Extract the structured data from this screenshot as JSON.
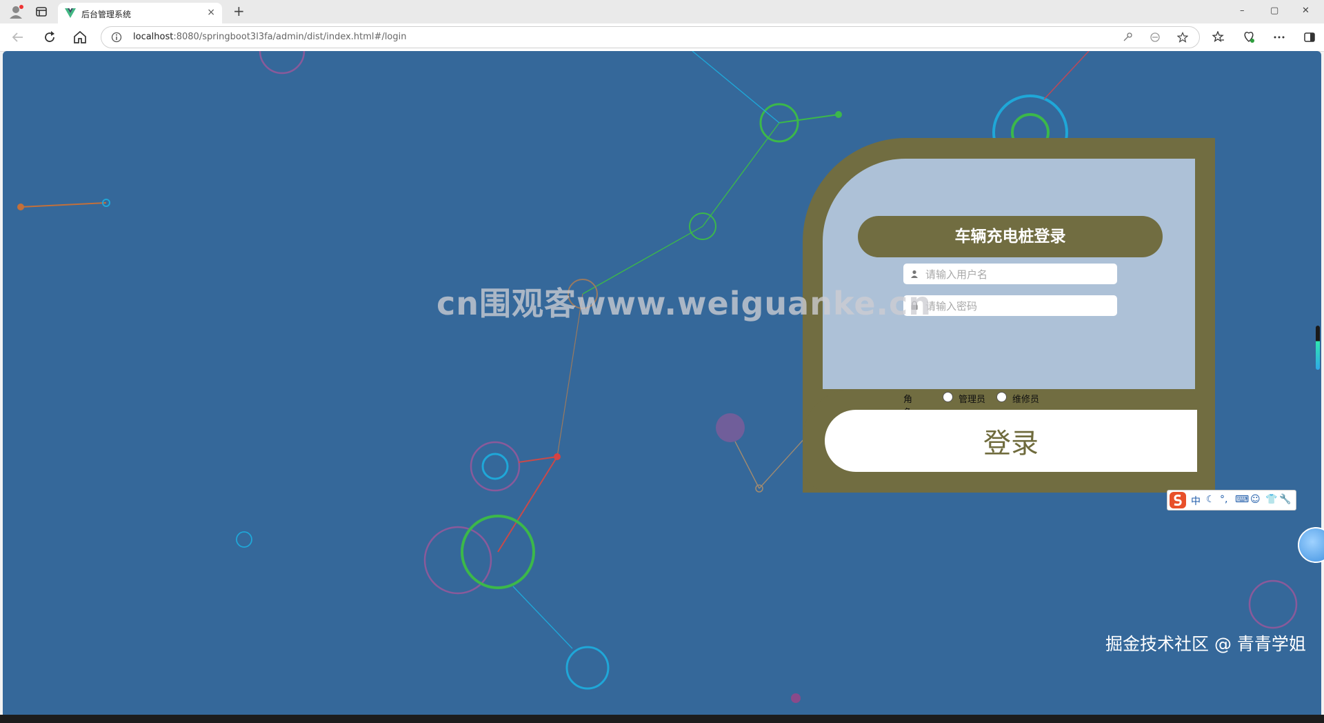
{
  "browser": {
    "tab_title": "后台管理系统",
    "tab_close": "×",
    "new_tab": "+",
    "url_host": "localhost",
    "url_rest": ":8080/springboot3l3fa/admin/dist/index.html#/login",
    "window_controls": [
      "–",
      "▢",
      "✕"
    ]
  },
  "login": {
    "title": "车辆充电桩登录",
    "username_placeholder": "请输入用户名",
    "password_placeholder": "请输入密码",
    "role_label": "角色",
    "roles": [
      "管理员",
      "维修员"
    ],
    "submit_label": "登录"
  },
  "overlay": {
    "watermark": "cn围观客www.weiguanke.cn",
    "credit": "掘金技术社区 @ 青青学姐"
  },
  "ime": {
    "items": [
      "中",
      "☾",
      "°,",
      "⌨",
      "☺",
      "👕",
      "🔧"
    ]
  },
  "colors": {
    "background": "#35689a",
    "card_accent": "#716d41",
    "card_panel": "#adc1d7"
  }
}
